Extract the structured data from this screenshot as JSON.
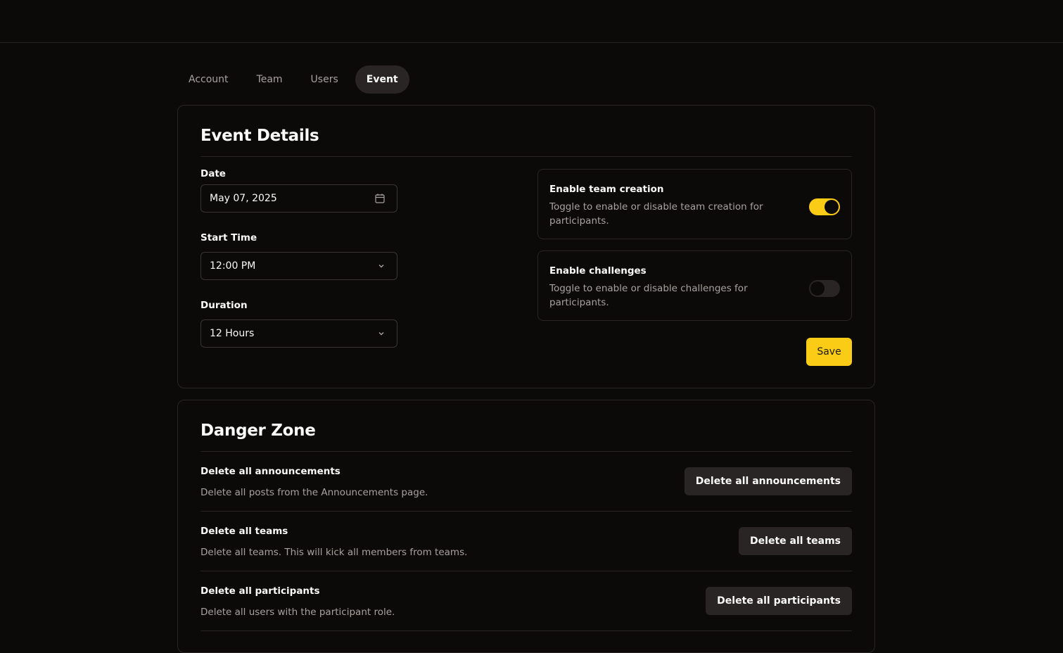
{
  "tabs": [
    {
      "label": "Account",
      "active": false
    },
    {
      "label": "Team",
      "active": false
    },
    {
      "label": "Users",
      "active": false
    },
    {
      "label": "Event",
      "active": true
    }
  ],
  "event_details": {
    "title": "Event Details",
    "date": {
      "label": "Date",
      "value": "May 07, 2025",
      "icon": "calendar-icon"
    },
    "start_time": {
      "label": "Start Time",
      "value": "12:00 PM",
      "icon": "chevron-down-icon"
    },
    "duration": {
      "label": "Duration",
      "value": "12 Hours",
      "icon": "chevron-down-icon"
    },
    "toggles": [
      {
        "title": "Enable team creation",
        "description": "Toggle to enable or disable team creation for participants.",
        "enabled": true
      },
      {
        "title": "Enable challenges",
        "description": "Toggle to enable or disable challenges for participants.",
        "enabled": false
      }
    ],
    "save_label": "Save"
  },
  "danger_zone": {
    "title": "Danger Zone",
    "rows": [
      {
        "title": "Delete all announcements",
        "description": "Delete all posts from the Announcements page.",
        "button": "Delete all announcements"
      },
      {
        "title": "Delete all teams",
        "description": "Delete all teams. This will kick all members from teams.",
        "button": "Delete all teams"
      },
      {
        "title": "Delete all participants",
        "description": "Delete all users with the participant role.",
        "button": "Delete all participants"
      }
    ]
  },
  "colors": {
    "background": "#0b0a09",
    "accent": "#facc15",
    "border": "#292524",
    "muted_text": "#a8a29e"
  }
}
